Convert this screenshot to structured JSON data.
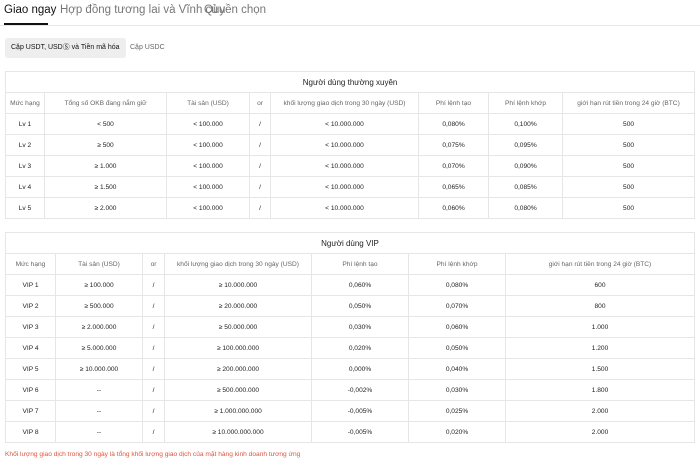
{
  "tabs": [
    "Giao ngay",
    "Hợp đồng tương lai và Vĩnh cửu",
    "Quyền chọn"
  ],
  "pills": [
    "Cặp USDT, USDⓈ và Tiền mã hóa",
    "Cặp USDC"
  ],
  "regular": {
    "title": "Người dùng thường xuyên",
    "headers": [
      "Mức hạng",
      "Tổng số OKB đang nắm giữ",
      "Tài sản (USD)",
      "or",
      "khối lượng giao dịch trong 30 ngày (USD)",
      "Phí lệnh tạo",
      "Phí lệnh khớp",
      "giới hạn rút tiền trong 24 giờ (BTC)"
    ],
    "rows": [
      [
        "Lv 1",
        "< 500",
        "< 100.000",
        "/",
        "< 10.000.000",
        "0,080%",
        "0,100%",
        "500"
      ],
      [
        "Lv 2",
        "≥ 500",
        "< 100.000",
        "/",
        "< 10.000.000",
        "0,075%",
        "0,095%",
        "500"
      ],
      [
        "Lv 3",
        "≥ 1.000",
        "< 100.000",
        "/",
        "< 10.000.000",
        "0,070%",
        "0,090%",
        "500"
      ],
      [
        "Lv 4",
        "≥ 1.500",
        "< 100.000",
        "/",
        "< 10.000.000",
        "0,065%",
        "0,085%",
        "500"
      ],
      [
        "Lv 5",
        "≥ 2.000",
        "< 100.000",
        "/",
        "< 10.000.000",
        "0,060%",
        "0,080%",
        "500"
      ]
    ]
  },
  "vip": {
    "title": "Người dùng VIP",
    "headers": [
      "Mức hạng",
      "Tài sản (USD)",
      "or",
      "khối lượng giao dịch trong 30 ngày (USD)",
      "Phí lệnh tạo",
      "Phí lệnh khớp",
      "giới hạn rút tiền trong 24 giờ (BTC)"
    ],
    "rows": [
      [
        "VIP 1",
        "≥ 100.000",
        "/",
        "≥ 10.000.000",
        "0,060%",
        "0,080%",
        "600"
      ],
      [
        "VIP 2",
        "≥ 500.000",
        "/",
        "≥ 20.000.000",
        "0,050%",
        "0,070%",
        "800"
      ],
      [
        "VIP 3",
        "≥ 2.000.000",
        "/",
        "≥ 50.000.000",
        "0,030%",
        "0,060%",
        "1.000"
      ],
      [
        "VIP 4",
        "≥ 5.000.000",
        "/",
        "≥ 100.000.000",
        "0,020%",
        "0,050%",
        "1.200"
      ],
      [
        "VIP 5",
        "≥ 10.000.000",
        "/",
        "≥ 200.000.000",
        "0,000%",
        "0,040%",
        "1.500"
      ],
      [
        "VIP 6",
        "--",
        "/",
        "≥ 500.000.000",
        "-0,002%",
        "0,030%",
        "1.800"
      ],
      [
        "VIP 7",
        "--",
        "/",
        "≥ 1.000.000.000",
        "-0,005%",
        "0,025%",
        "2.000"
      ],
      [
        "VIP 8",
        "--",
        "/",
        "≥ 10.000.000.000",
        "-0,005%",
        "0,020%",
        "2.000"
      ]
    ]
  },
  "footnote": "Khối lượng giao dịch trong 30 ngày là tổng khối lượng giao dịch của mặt hàng kinh doanh tương ứng"
}
